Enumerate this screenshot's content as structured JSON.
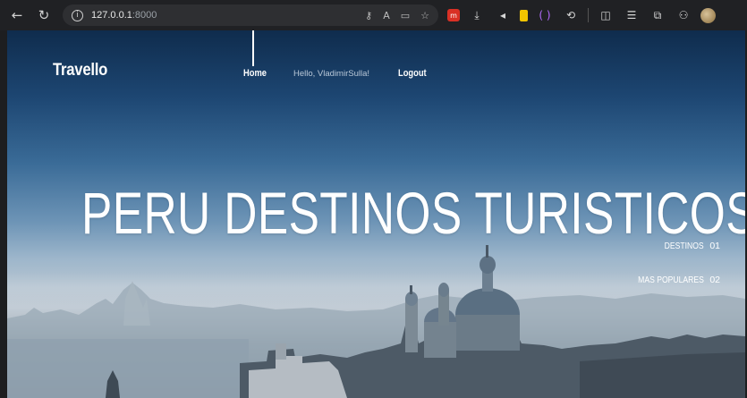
{
  "browser": {
    "url_host": "127.0.0.1",
    "url_port": ":8000",
    "icons": {
      "back": "back-arrow-icon",
      "reload": "reload-icon",
      "info": "info-icon"
    }
  },
  "site": {
    "logo": "Travello",
    "nav": {
      "home": "Home",
      "greeting": "Hello, VladimirSulla!",
      "logout": "Logout"
    },
    "hero_title": "PERU DESTINOS TURISTICOS",
    "slides": [
      {
        "label": "DESTINOS",
        "number": "01"
      },
      {
        "label": "MAS POPULARES",
        "number": "02"
      }
    ]
  },
  "colors": {
    "browser_bg": "#202124",
    "text_white": "#ffffff",
    "sky_top": "#0f2c4d",
    "sky_mid": "#6d94b6",
    "haze": "#b7c5d1"
  }
}
